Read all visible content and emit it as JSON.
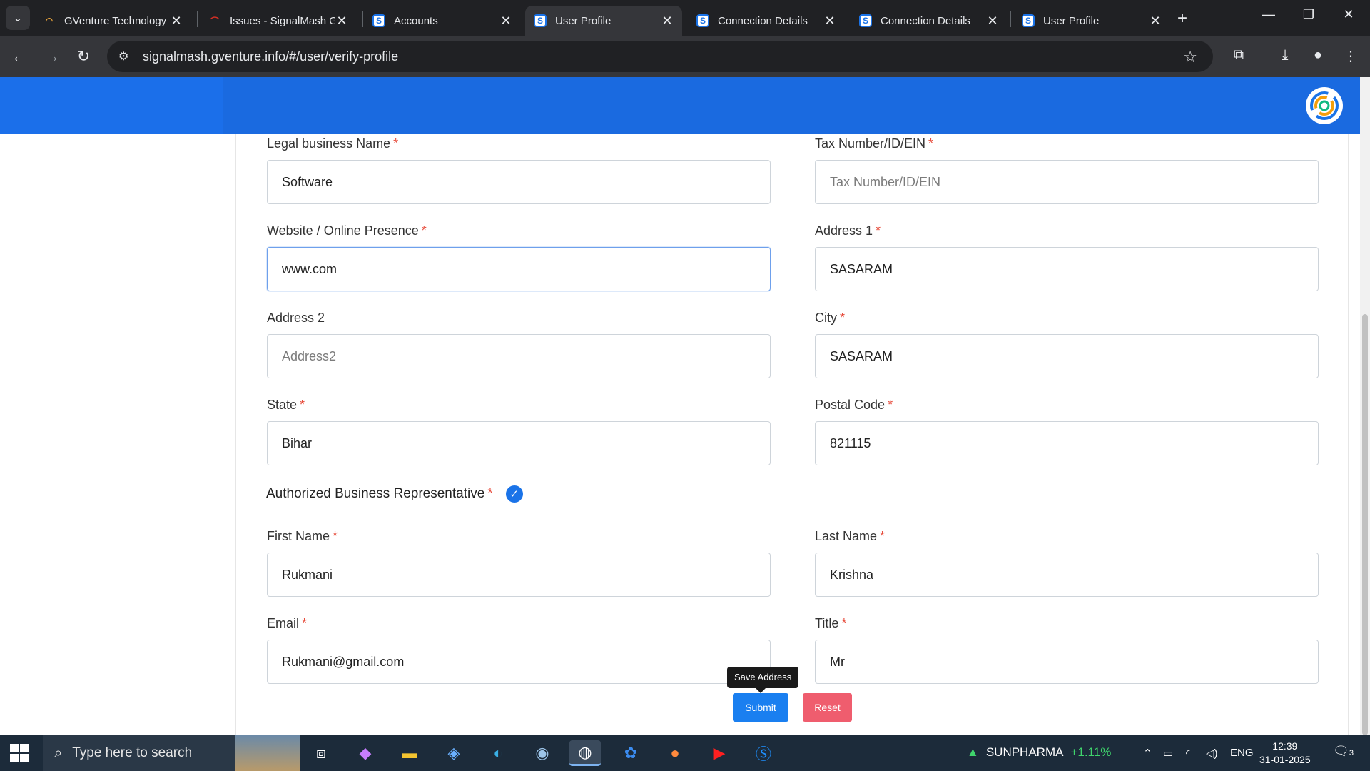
{
  "browser": {
    "tabs": [
      {
        "title": "GVenture Technology",
        "favicon": "rainbow-icon",
        "active": false
      },
      {
        "title": "Issues - SignalMash G",
        "favicon": "jira-icon",
        "active": false
      },
      {
        "title": "Accounts",
        "favicon": "signalmash-icon",
        "active": false
      },
      {
        "title": "User Profile",
        "favicon": "signalmash-icon",
        "active": true
      },
      {
        "title": "Connection Details",
        "favicon": "signalmash-icon",
        "active": false
      },
      {
        "title": "Connection Details",
        "favicon": "signalmash-icon",
        "active": false
      },
      {
        "title": "User Profile",
        "favicon": "signalmash-icon",
        "active": false
      }
    ],
    "url": "signalmash.gventure.info/#/user/verify-profile"
  },
  "form": {
    "legal_name": {
      "label": "Legal business Name",
      "value": "Software",
      "placeholder": ""
    },
    "tax_number": {
      "label": "Tax Number/ID/EIN",
      "value": "",
      "placeholder": "Tax Number/ID/EIN"
    },
    "website": {
      "label": "Website / Online Presence",
      "value": "www.com",
      "placeholder": ""
    },
    "address1": {
      "label": "Address 1",
      "value": "SASARAM",
      "placeholder": ""
    },
    "address2": {
      "label": "Address 2",
      "value": "",
      "placeholder": "Address2"
    },
    "city": {
      "label": "City",
      "value": "SASARAM",
      "placeholder": ""
    },
    "state": {
      "label": "State",
      "value": "Bihar",
      "placeholder": ""
    },
    "postal_code": {
      "label": "Postal Code",
      "value": "821115",
      "placeholder": ""
    },
    "rep_section": "Authorized Business Representative",
    "first_name": {
      "label": "First Name",
      "value": "Rukmani",
      "placeholder": ""
    },
    "last_name": {
      "label": "Last Name",
      "value": "Krishna",
      "placeholder": ""
    },
    "email": {
      "label": "Email",
      "value": "Rukmani@gmail.com",
      "placeholder": ""
    },
    "title": {
      "label": "Title",
      "value": "Mr",
      "placeholder": ""
    },
    "required_mark": "*",
    "tooltip": "Save Address",
    "submit_label": "Submit",
    "reset_label": "Reset"
  },
  "taskbar": {
    "search_placeholder": "Type here to search",
    "ticker_symbol": "SUNPHARMA",
    "ticker_change": "+1.11%",
    "language": "ENG",
    "time": "12:39",
    "date": "31-01-2025",
    "notification_count": "3"
  },
  "colors": {
    "header_blue": "#1a6ae0",
    "submit_blue": "#1a7ff0",
    "reset_red": "#ef5d6e",
    "required_red": "#e74c3c"
  }
}
